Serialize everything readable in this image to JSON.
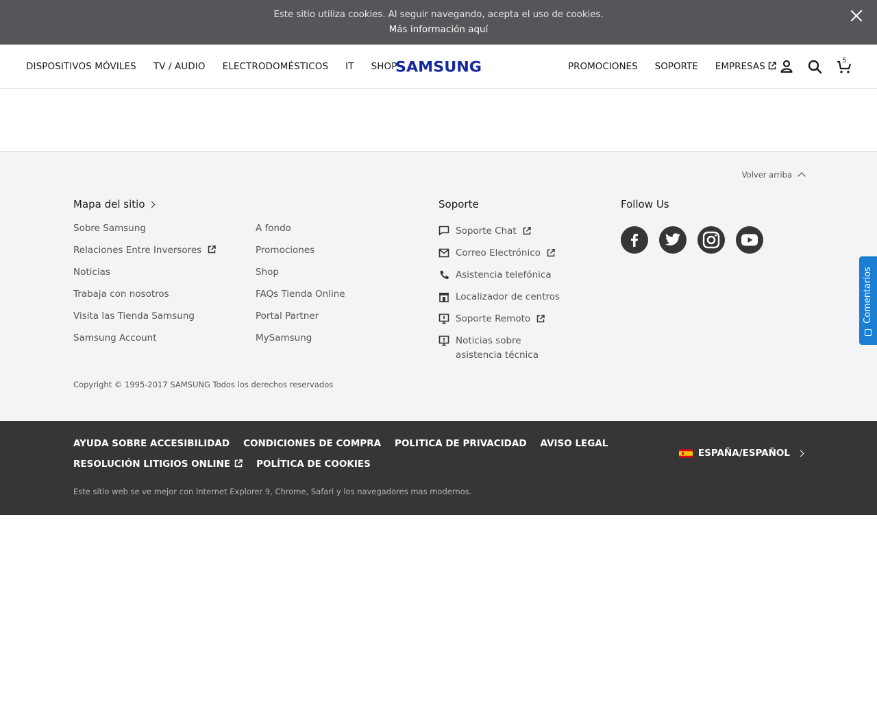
{
  "cookie_bar": {
    "message": "Este sitio utiliza cookies. Al seguir navegando, acepta el uso de cookies.",
    "more_link": "Más información aquí"
  },
  "header": {
    "logo_text": "SAMSUNG",
    "nav_left": [
      "DISPOSITIVOS MÓVILES",
      "TV / AUDIO",
      "ELECTRODOMÉSTICOS",
      "IT",
      "SHOP"
    ],
    "nav_right": {
      "promociones": "PROMOCIONES",
      "soporte": "SOPORTE",
      "empresas": "EMPRESAS"
    },
    "cart_count": "5",
    "icons": [
      "user-icon",
      "search-icon",
      "cart-icon"
    ]
  },
  "footer": {
    "back_to_top": "Volver arriba",
    "sitemap_title": "Mapa del sitio",
    "sitemap_col1": [
      "Sobre Samsung",
      "Relaciones Entre Inversores",
      "Noticias",
      "Trabaja con nosotros",
      "Visita las Tienda Samsung",
      "Samsung Account"
    ],
    "sitemap_col2": [
      "A fondo",
      "Promociones",
      "Shop",
      "FAQs Tienda Online",
      "Portal Partner",
      "MySamsung"
    ],
    "support_title": "Soporte",
    "support_links": [
      "Soporte Chat",
      "Correo Electrónico",
      "Asistencia telefónica",
      "Localizador de centros",
      "Soporte Remoto",
      "Noticias sobre asistencia técnica"
    ],
    "follow_title": "Follow Us",
    "social": [
      "facebook-icon",
      "twitter-icon",
      "instagram-icon",
      "youtube-icon"
    ],
    "copyright": "Copyright © 1995-2017 SAMSUNG Todos los derechos reservados"
  },
  "bottom_bar": {
    "row1": [
      "AYUDA SOBRE ACCESIBILIDAD",
      "CONDICIONES DE COMPRA",
      "POLITICA DE PRIVACIDAD",
      "AVISO LEGAL"
    ],
    "row2": [
      "RESOLUCIÓN LITIGIOS ONLINE",
      "POLÍTICA DE COOKIES"
    ],
    "browser_note": "Este sitio web se ve mejor con Internet Explorer 9, Chrome, Safari y los navegadores mas modernos.",
    "locale": "ESPAÑA/ESPAÑOL"
  },
  "feedback_tab": "Comentarios",
  "colors": {
    "cookie_bg": "#54565a",
    "footer_bg": "#f4f4f4",
    "bottom_bg": "#363636",
    "brand_blue": "#1428a0",
    "feedback_blue": "#1a7fd3"
  }
}
